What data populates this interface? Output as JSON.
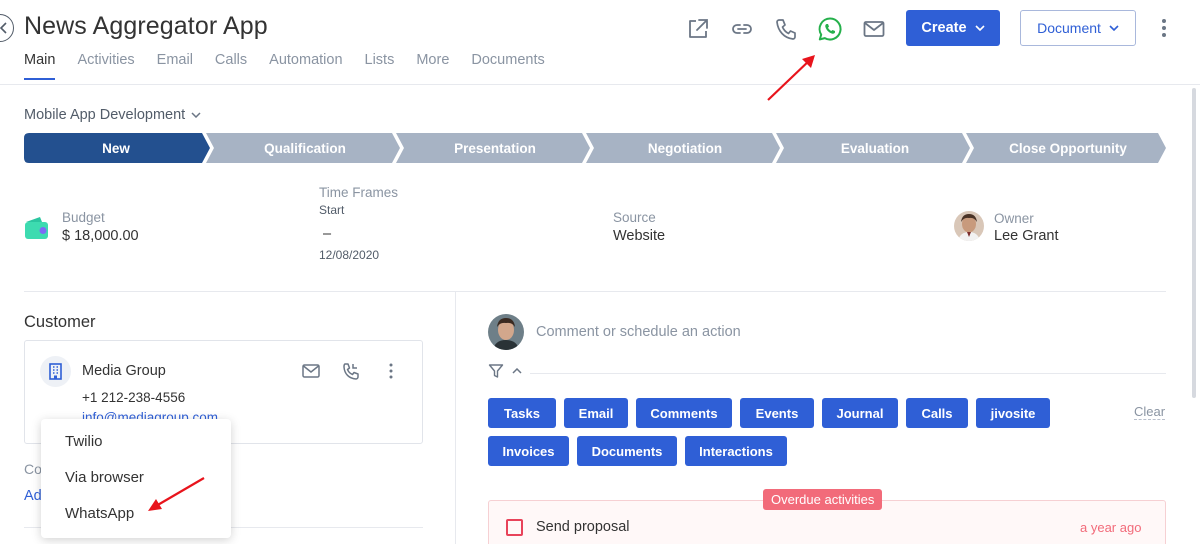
{
  "header": {
    "title": "News Aggregator App",
    "tabs": [
      {
        "label": "Main",
        "active": true
      },
      {
        "label": "Activities"
      },
      {
        "label": "Email"
      },
      {
        "label": "Calls"
      },
      {
        "label": "Automation"
      },
      {
        "label": "Lists"
      },
      {
        "label": "More"
      },
      {
        "label": "Documents"
      }
    ],
    "icons": [
      "external-link-icon",
      "link-icon",
      "phone-icon",
      "whatsapp-icon",
      "mail-icon"
    ],
    "create_label": "Create",
    "document_label": "Document"
  },
  "pipeline": {
    "name": "Mobile App Development",
    "stages": [
      {
        "label": "New",
        "active": true
      },
      {
        "label": "Qualification"
      },
      {
        "label": "Presentation"
      },
      {
        "label": "Negotiation"
      },
      {
        "label": "Evaluation"
      },
      {
        "label": "Close Opportunity"
      }
    ]
  },
  "fields": {
    "budget": {
      "label": "Budget",
      "value": "$ 18,000.00"
    },
    "time_frames": {
      "label": "Time Frames",
      "start_label": "Start",
      "dash": "–",
      "end": "12/08/2020"
    },
    "source": {
      "label": "Source",
      "value": "Website"
    },
    "owner": {
      "label": "Owner",
      "value": "Lee Grant"
    }
  },
  "customer": {
    "title": "Customer",
    "company": "Media Group",
    "phone": "+1 212-238-4556",
    "email": "info@mediagroup.com",
    "contact_label_partial": "Co",
    "add_partial": "Ad"
  },
  "call_menu": {
    "items": [
      "Twilio",
      "Via browser",
      "WhatsApp"
    ]
  },
  "activity": {
    "comment_placeholder": "Comment or schedule an action",
    "chips_row1": [
      "Tasks",
      "Email",
      "Comments",
      "Events",
      "Journal",
      "Calls",
      "jivosite"
    ],
    "chips_row2": [
      "Invoices",
      "Documents",
      "Interactions"
    ],
    "clear_label": "Clear",
    "overdue_label": "Overdue activities",
    "task": {
      "title": "Send proposal",
      "time": "a year ago"
    }
  },
  "colors": {
    "accent": "#2f5fd6",
    "stage_active": "#23508f",
    "stage_inactive": "#a7b3c4",
    "whatsapp": "#25b04b",
    "overdue": "#f26b7a",
    "annotation": "#e8141c"
  }
}
